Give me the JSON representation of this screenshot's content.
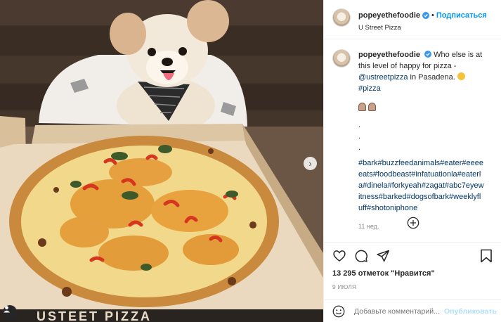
{
  "post": {
    "username": "popeyethefoodie",
    "follow_label": "Подписаться",
    "follow_separator": "•",
    "location": "U Street Pizza",
    "caption": {
      "username": "popeyethefoodie",
      "text_before_mention": "Who else is at this level of happy for pizza - ",
      "mention": "@ustreetpizza",
      "text_after_mention": " in Pasadena. ",
      "hashtag_pizza": "#pizza",
      "dots": [
        ".",
        ".",
        "."
      ],
      "hashtags": "#bark#buzzfeedanimals#eater#eeeeeats#foodbeast#infatuationla#eaterla#dinela#forkyeah#zagat#abc7eyewitness#barked#dogsofbark#weeklyfluff#shotoniphone",
      "time_ago": "11 нед."
    },
    "likes": "13 295 отметок \"Нравится\"",
    "date": "9 ИЮЛЯ",
    "comment_placeholder": "Добавьте комментарий...",
    "publish_label": "Опубликовать",
    "icons": {
      "verified": "verified-badge-icon",
      "like": "heart-icon",
      "comment": "comment-icon",
      "share": "share-icon",
      "save": "bookmark-icon",
      "emoji": "smile-icon",
      "more": "plus-circle-icon",
      "next": "chevron-right-icon",
      "tag": "user-tag-icon"
    },
    "colors": {
      "link": "#00376b",
      "accent": "#0095f6",
      "muted": "#8e8e8e"
    }
  }
}
